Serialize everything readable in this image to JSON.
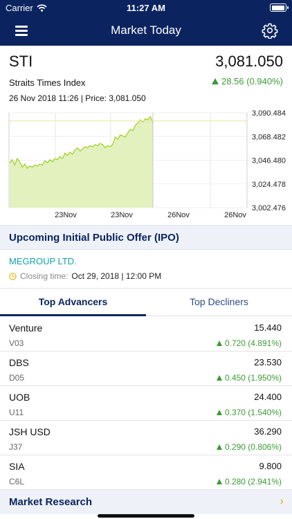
{
  "status_bar": {
    "carrier": "Carrier",
    "time": "11:27 AM"
  },
  "nav": {
    "title": "Market Today"
  },
  "index": {
    "symbol": "STI",
    "value": "3,081.050",
    "name": "Straits Times Index",
    "change": "28.56 (0.940%)",
    "meta": "26 Nov 2018 11:26 | Price: 3,081.050"
  },
  "chart_data": {
    "type": "area",
    "y_ticks": [
      "3,090.484",
      "3,068.482",
      "3,046.480",
      "3,024.478",
      "3,002.476"
    ],
    "x_ticks": [
      "23Nov",
      "23Nov",
      "26Nov",
      "26Nov"
    ],
    "ylim": [
      3002.476,
      3090.484
    ],
    "values": [
      3044,
      3047,
      3042,
      3048,
      3045,
      3040,
      3043,
      3039,
      3041,
      3040,
      3042,
      3041,
      3043,
      3042,
      3046,
      3044,
      3047,
      3045,
      3048,
      3047,
      3050,
      3048,
      3053,
      3051,
      3054,
      3052,
      3056,
      3058,
      3055,
      3057,
      3059,
      3058,
      3060,
      3059,
      3061,
      3060,
      3062,
      3061,
      3058,
      3060,
      3059,
      3061,
      3068,
      3066,
      3070,
      3069,
      3068,
      3072,
      3075,
      3074,
      3079,
      3081,
      3084,
      3082,
      3085,
      3084,
      3087,
      3081
    ],
    "colors": {
      "line": "#9bcf1f",
      "fill": "#e2f1bd"
    }
  },
  "ipo": {
    "header": "Upcoming Initial Public Offer (IPO)",
    "company": "MEGROUP LTD.",
    "closing_label": "Closing time:",
    "closing_value": "Oct 29, 2018 | 12:00 PM"
  },
  "tabs": {
    "advancers": "Top Advancers",
    "decliners": "Top Decliners"
  },
  "stocks": [
    {
      "name": "Venture",
      "code": "V03",
      "price": "15.440",
      "change": "0.720 (4.891%)"
    },
    {
      "name": "DBS",
      "code": "D05",
      "price": "23.530",
      "change": "0.450 (1.950%)"
    },
    {
      "name": "UOB",
      "code": "U11",
      "price": "24.400",
      "change": "0.370 (1.540%)"
    },
    {
      "name": "JSH USD",
      "code": "J37",
      "price": "36.290",
      "change": "0.290 (0.806%)"
    },
    {
      "name": "SIA",
      "code": "C6L",
      "price": "9.800",
      "change": "0.280 (2.941%)"
    }
  ],
  "research": {
    "label": "Market Research"
  },
  "colors": {
    "brand": "#0b2460",
    "up": "#3c9a35",
    "accent": "#12a2a8"
  }
}
